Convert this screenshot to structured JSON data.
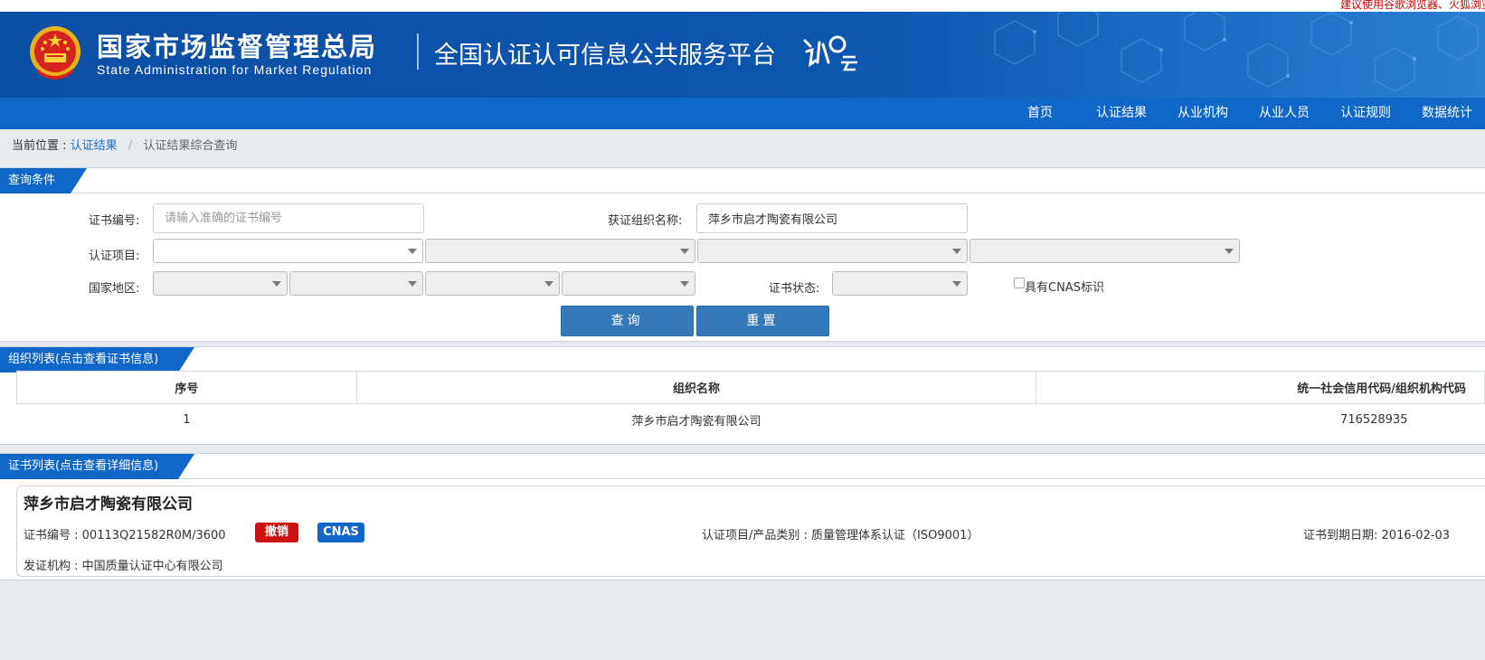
{
  "top_notice": "建议使用谷歌浏览器、火狐浏览器",
  "header": {
    "org_name_cn": "国家市场监督管理总局",
    "org_name_en": "State Administration  for  Market Regulation",
    "platform_title": "全国认证认可信息公共服务平台",
    "logo_icon": "renyun-logo-icon",
    "emblem_icon": "national-emblem-icon"
  },
  "nav": {
    "items": [
      "首页",
      "认证结果",
      "从业机构",
      "从业人员",
      "认证规则",
      "数据统计"
    ]
  },
  "breadcrumb": {
    "prefix": "当前位置 :",
    "link": "认证结果",
    "separator": "/",
    "current": "认证结果综合查询"
  },
  "query": {
    "section_title": "查询条件",
    "cert_no_label": "证书编号:",
    "cert_no_placeholder": "请输入准确的证书编号",
    "cert_no_value": "",
    "org_name_label": "获证组织名称:",
    "org_name_value": "萍乡市启才陶瓷有限公司",
    "project_label": "认证项目:",
    "region_label": "国家地区:",
    "status_label": "证书状态:",
    "cnas_checkbox_label": "具有CNAS标识",
    "cnas_checked": false,
    "search_button": "查询",
    "reset_button": "重置"
  },
  "org_list": {
    "section_title": "组织列表(点击查看证书信息)",
    "columns": [
      "序号",
      "组织名称",
      "统一社会信用代码/组织机构代码"
    ],
    "rows": [
      [
        "1",
        "萍乡市启才陶瓷有限公司",
        "716528935"
      ]
    ]
  },
  "cert_list": {
    "section_title": "证书列表(点击查看详细信息)",
    "items": [
      {
        "org_name": "萍乡市启才陶瓷有限公司",
        "cert_no_label": "证书编号 :",
        "cert_no": "00113Q21582R0M/3600",
        "status_badge": "撤销",
        "status_color": "#cc1111",
        "cnas_badge": "CNAS",
        "cnas_color": "#1067c8",
        "project_label": "认证项目/产品类别 :",
        "project_value": "质量管理体系认证（ISO9001）",
        "expiry_label": "证书到期日期:",
        "expiry_value": "2016-02-03",
        "issuer_label": "发证机构 :",
        "issuer_value": "中国质量认证中心有限公司"
      }
    ]
  },
  "colors": {
    "header_blue": "#0c55ad",
    "nav_blue": "#1067c8",
    "button_blue": "#3579b9",
    "link_blue": "#1a6cc4"
  }
}
